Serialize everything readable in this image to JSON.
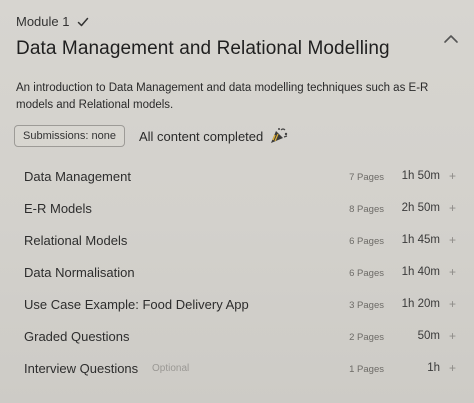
{
  "module": {
    "label": "Module 1",
    "title": "Data Management and Relational Modelling",
    "description": "An introduction to Data Management and data modelling techniques such as E-R models and Relational models."
  },
  "status": {
    "submissions": "Submissions: none",
    "completed": "All content completed"
  },
  "items": [
    {
      "title": "Data Management",
      "pages": "7 Pages",
      "duration": "1h 50m",
      "expand": "+"
    },
    {
      "title": "E-R Models",
      "pages": "8 Pages",
      "duration": "2h 50m",
      "expand": "+"
    },
    {
      "title": "Relational Models",
      "pages": "6 Pages",
      "duration": "1h 45m",
      "expand": "+"
    },
    {
      "title": "Data Normalisation",
      "pages": "6 Pages",
      "duration": "1h 40m",
      "expand": "+"
    },
    {
      "title": "Use Case Example: Food Delivery App",
      "pages": "3 Pages",
      "duration": "1h 20m",
      "expand": "+"
    },
    {
      "title": "Graded Questions",
      "pages": "2 Pages",
      "duration": "50m",
      "expand": "+"
    },
    {
      "title": "Interview Questions",
      "optional": "Optional",
      "pages": "1 Pages",
      "duration": "1h",
      "expand": "+"
    }
  ],
  "icons": {
    "check": "check-icon",
    "collapse": "chevron-up-icon",
    "celebrate": "party-popper-icon"
  }
}
